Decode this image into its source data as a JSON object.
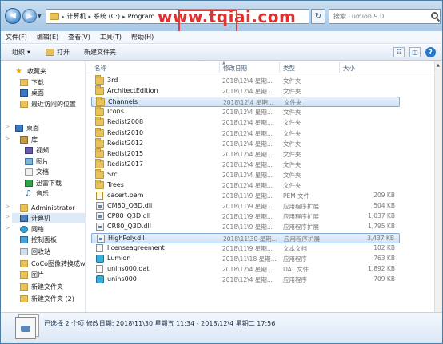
{
  "address": {
    "crumbs": [
      "计算机",
      "系统 (C:)",
      "Program"
    ],
    "watermark": "www.tqiai.com"
  },
  "search": {
    "placeholder": "搜索 Lumion 9.0"
  },
  "menu": [
    "文件(F)",
    "编辑(E)",
    "查看(V)",
    "工具(T)",
    "帮助(H)"
  ],
  "toolbar": {
    "organize": "组织",
    "open": "打开",
    "new_folder": "新建文件夹"
  },
  "nav": [
    {
      "label": "收藏夹",
      "icon": "star-icon"
    },
    {
      "label": "下载",
      "icon": "folder-icon"
    },
    {
      "label": "桌面",
      "icon": "desktop-icon"
    },
    {
      "label": "最近访问的位置",
      "icon": "recent-icon"
    },
    {
      "label": "桌面",
      "icon": "desktop-icon"
    },
    {
      "label": "库",
      "icon": "library-icon"
    },
    {
      "label": "视频",
      "icon": "video-icon"
    },
    {
      "label": "图片",
      "icon": "picture-icon"
    },
    {
      "label": "文档",
      "icon": "document-icon"
    },
    {
      "label": "迅雷下载",
      "icon": "download-icon"
    },
    {
      "label": "音乐",
      "icon": "music-icon"
    },
    {
      "label": "Administrator",
      "icon": "user-folder-icon"
    },
    {
      "label": "计算机",
      "icon": "computer-icon"
    },
    {
      "label": "网络",
      "icon": "network-icon"
    },
    {
      "label": "控制面板",
      "icon": "control-panel-icon"
    },
    {
      "label": "回收站",
      "icon": "recycle-bin-icon"
    },
    {
      "label": "CoCo图像转换成wo",
      "icon": "folder-icon"
    },
    {
      "label": "图片",
      "icon": "folder-icon"
    },
    {
      "label": "新建文件夹",
      "icon": "folder-icon"
    },
    {
      "label": "新建文件夹 (2)",
      "icon": "folder-icon"
    }
  ],
  "columns": {
    "name": "名称",
    "date": "修改日期",
    "type": "类型",
    "size": "大小"
  },
  "files": [
    {
      "name": "3rd",
      "date": "2018\\12\\4 星期...",
      "type": "文件夹",
      "size": "",
      "kind": "folder"
    },
    {
      "name": "ArchitectEdition",
      "date": "2018\\12\\4 星期...",
      "type": "文件夹",
      "size": "",
      "kind": "folder"
    },
    {
      "name": "Channels",
      "date": "2018\\12\\4 星期...",
      "type": "文件夹",
      "size": "",
      "kind": "folder",
      "selected": true
    },
    {
      "name": "Icons",
      "date": "2018\\12\\4 星期...",
      "type": "文件夹",
      "size": "",
      "kind": "folder"
    },
    {
      "name": "Redist2008",
      "date": "2018\\12\\4 星期...",
      "type": "文件夹",
      "size": "",
      "kind": "folder"
    },
    {
      "name": "Redist2010",
      "date": "2018\\12\\4 星期...",
      "type": "文件夹",
      "size": "",
      "kind": "folder"
    },
    {
      "name": "Redist2012",
      "date": "2018\\12\\4 星期...",
      "type": "文件夹",
      "size": "",
      "kind": "folder"
    },
    {
      "name": "Redist2015",
      "date": "2018\\12\\4 星期...",
      "type": "文件夹",
      "size": "",
      "kind": "folder"
    },
    {
      "name": "Redist2017",
      "date": "2018\\12\\4 星期...",
      "type": "文件夹",
      "size": "",
      "kind": "folder"
    },
    {
      "name": "Src",
      "date": "2018\\12\\4 星期...",
      "type": "文件夹",
      "size": "",
      "kind": "folder"
    },
    {
      "name": "Trees",
      "date": "2018\\12\\4 星期...",
      "type": "文件夹",
      "size": "",
      "kind": "folder"
    },
    {
      "name": "cacert.pem",
      "date": "2018\\11\\9 星期...",
      "type": "PEM 文件",
      "size": "209 KB",
      "kind": "cert"
    },
    {
      "name": "CM80_Q3D.dll",
      "date": "2018\\11\\9 星期...",
      "type": "应用程序扩展",
      "size": "504 KB",
      "kind": "dll"
    },
    {
      "name": "CP80_Q3D.dll",
      "date": "2018\\11\\9 星期...",
      "type": "应用程序扩展",
      "size": "1,037 KB",
      "kind": "dll"
    },
    {
      "name": "CR80_Q3D.dll",
      "date": "2018\\11\\9 星期...",
      "type": "应用程序扩展",
      "size": "1,795 KB",
      "kind": "dll"
    },
    {
      "name": "HighPoly.dll",
      "date": "2018\\11\\30 星期...",
      "type": "应用程序扩展",
      "size": "3,437 KB",
      "kind": "dll",
      "selected": true
    },
    {
      "name": "licenseagreement",
      "date": "2018\\11\\9 星期...",
      "type": "文本文档",
      "size": "102 KB",
      "kind": "file"
    },
    {
      "name": "Lumion",
      "date": "2018\\11\\18 星期...",
      "type": "应用程序",
      "size": "763 KB",
      "kind": "exe"
    },
    {
      "name": "unins000.dat",
      "date": "2018\\12\\4 星期...",
      "type": "DAT 文件",
      "size": "1,892 KB",
      "kind": "file"
    },
    {
      "name": "unins000",
      "date": "2018\\12\\4 星期...",
      "type": "应用程序",
      "size": "709 KB",
      "kind": "exe"
    }
  ],
  "details": {
    "summary": "已选择 2 个项   修改日期: 2018\\11\\30 星期五 11:34 - 2018\\12\\4 星期二 17:56"
  }
}
